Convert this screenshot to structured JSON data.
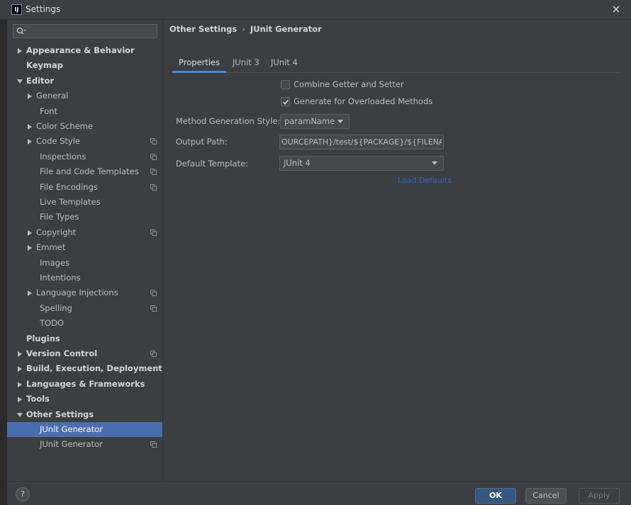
{
  "window": {
    "logo_text": "IJ",
    "title": "Settings",
    "close_glyph": "×"
  },
  "search": {
    "placeholder": "",
    "value": ""
  },
  "tree": [
    {
      "label": "Appearance & Behavior",
      "level": 0,
      "arrow": "collapsed",
      "bold": true,
      "scope_icon": false,
      "selected": false
    },
    {
      "label": "Keymap",
      "level": 0,
      "arrow": "none",
      "bold": true,
      "scope_icon": false,
      "selected": false
    },
    {
      "label": "Editor",
      "level": 0,
      "arrow": "expanded",
      "bold": true,
      "scope_icon": false,
      "selected": false
    },
    {
      "label": "General",
      "level": 1,
      "arrow": "collapsed",
      "bold": false,
      "scope_icon": false,
      "selected": false
    },
    {
      "label": "Font",
      "level": 2,
      "arrow": "none",
      "bold": false,
      "scope_icon": false,
      "selected": false
    },
    {
      "label": "Color Scheme",
      "level": 1,
      "arrow": "collapsed",
      "bold": false,
      "scope_icon": false,
      "selected": false
    },
    {
      "label": "Code Style",
      "level": 1,
      "arrow": "collapsed",
      "bold": false,
      "scope_icon": true,
      "selected": false
    },
    {
      "label": "Inspections",
      "level": 2,
      "arrow": "none",
      "bold": false,
      "scope_icon": true,
      "selected": false
    },
    {
      "label": "File and Code Templates",
      "level": 2,
      "arrow": "none",
      "bold": false,
      "scope_icon": true,
      "selected": false
    },
    {
      "label": "File Encodings",
      "level": 2,
      "arrow": "none",
      "bold": false,
      "scope_icon": true,
      "selected": false
    },
    {
      "label": "Live Templates",
      "level": 2,
      "arrow": "none",
      "bold": false,
      "scope_icon": false,
      "selected": false
    },
    {
      "label": "File Types",
      "level": 2,
      "arrow": "none",
      "bold": false,
      "scope_icon": false,
      "selected": false
    },
    {
      "label": "Copyright",
      "level": 1,
      "arrow": "collapsed",
      "bold": false,
      "scope_icon": true,
      "selected": false
    },
    {
      "label": "Emmet",
      "level": 1,
      "arrow": "collapsed",
      "bold": false,
      "scope_icon": false,
      "selected": false
    },
    {
      "label": "Images",
      "level": 2,
      "arrow": "none",
      "bold": false,
      "scope_icon": false,
      "selected": false
    },
    {
      "label": "Intentions",
      "level": 2,
      "arrow": "none",
      "bold": false,
      "scope_icon": false,
      "selected": false
    },
    {
      "label": "Language Injections",
      "level": 1,
      "arrow": "collapsed",
      "bold": false,
      "scope_icon": true,
      "selected": false
    },
    {
      "label": "Spelling",
      "level": 2,
      "arrow": "none",
      "bold": false,
      "scope_icon": true,
      "selected": false
    },
    {
      "label": "TODO",
      "level": 2,
      "arrow": "none",
      "bold": false,
      "scope_icon": false,
      "selected": false
    },
    {
      "label": "Plugins",
      "level": 0,
      "arrow": "none",
      "bold": true,
      "scope_icon": false,
      "selected": false
    },
    {
      "label": "Version Control",
      "level": 0,
      "arrow": "collapsed",
      "bold": true,
      "scope_icon": true,
      "selected": false
    },
    {
      "label": "Build, Execution, Deployment",
      "level": 0,
      "arrow": "collapsed",
      "bold": true,
      "scope_icon": false,
      "selected": false
    },
    {
      "label": "Languages & Frameworks",
      "level": 0,
      "arrow": "collapsed",
      "bold": true,
      "scope_icon": false,
      "selected": false
    },
    {
      "label": "Tools",
      "level": 0,
      "arrow": "collapsed",
      "bold": true,
      "scope_icon": false,
      "selected": false
    },
    {
      "label": "Other Settings",
      "level": 0,
      "arrow": "expanded",
      "bold": true,
      "scope_icon": false,
      "selected": false
    },
    {
      "label": "JUnit Generator",
      "level": 2,
      "arrow": "none",
      "bold": false,
      "scope_icon": false,
      "selected": true
    },
    {
      "label": "JUnit Generator",
      "level": 2,
      "arrow": "none",
      "bold": false,
      "scope_icon": true,
      "selected": false
    }
  ],
  "breadcrumb": {
    "parent": "Other Settings",
    "separator": "›",
    "current": "JUnit Generator"
  },
  "main": {
    "tabs": [
      {
        "label": "Properties",
        "active": true
      },
      {
        "label": "JUnit 3",
        "active": false
      },
      {
        "label": "JUnit 4",
        "active": false
      }
    ],
    "checkboxes": [
      {
        "label": "Combine Getter and Setter",
        "checked": false
      },
      {
        "label": "Generate for Overloaded Methods",
        "checked": true
      }
    ],
    "form": {
      "method_style": {
        "label": "Method Generation Style:",
        "value": "paramName"
      },
      "output_path": {
        "label": "Output Path:",
        "value": "OURCEPATH}/test/${PACKAGE}/${FILENAME}"
      },
      "default_template": {
        "label": "Default Template:",
        "value": "JUnit 4"
      }
    },
    "load_defaults_link": "Load Defaults"
  },
  "footer": {
    "help_label": "?",
    "ok_label": "OK",
    "cancel_label": "Cancel",
    "apply_label": "Apply",
    "apply_enabled": false
  },
  "colors": {
    "background": "#3C3F41",
    "selection": "#4B6EAF",
    "primary_button": "#365880",
    "link": "#2F65CA",
    "tab_underline": "#4A88C7"
  }
}
